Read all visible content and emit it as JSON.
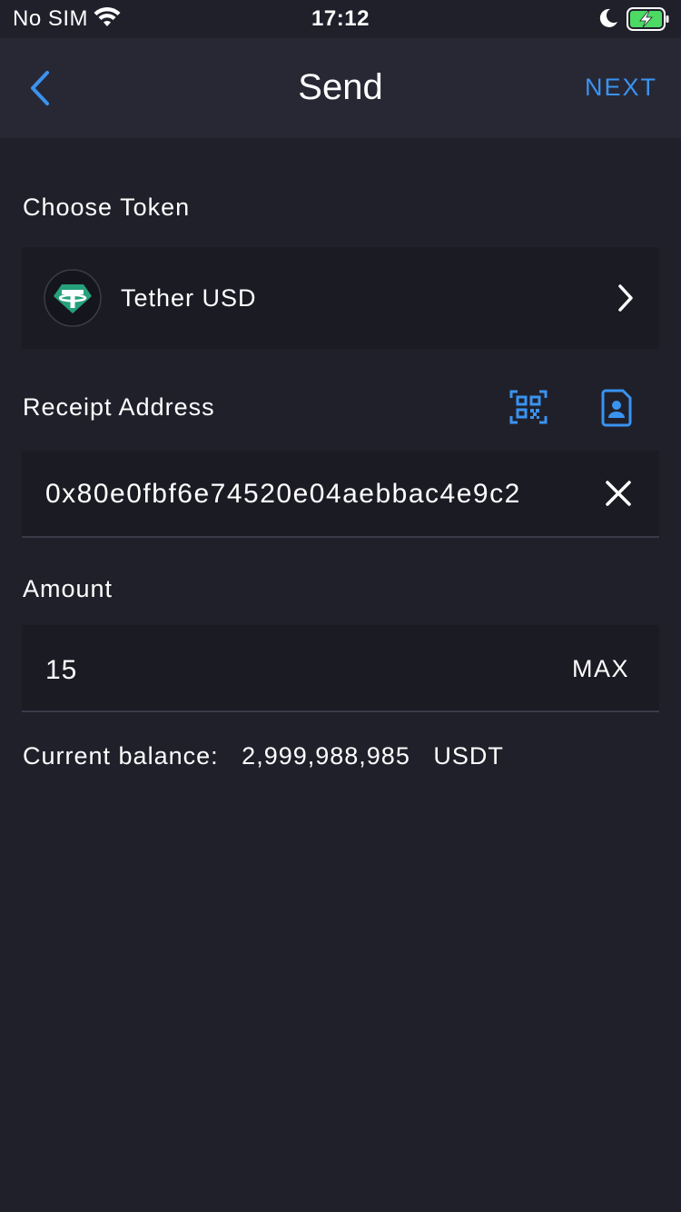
{
  "status_bar": {
    "carrier": "No SIM",
    "time": "17:12",
    "icons": [
      "wifi-icon",
      "moon-icon",
      "battery-charging-icon"
    ],
    "battery_color": "#4cd964"
  },
  "nav": {
    "back_icon": "chevron-left-icon",
    "title": "Send",
    "next_label": "NEXT"
  },
  "token": {
    "section_label": "Choose Token",
    "name": "Tether USD",
    "logo_icon": "tether-logo",
    "chevron_icon": "chevron-right-icon"
  },
  "address": {
    "section_label": "Receipt Address",
    "value": "0x80e0fbf6e74520e04aebbac4e9c2",
    "qr_icon": "qr-scan-icon",
    "contacts_icon": "contact-book-icon",
    "clear_icon": "close-icon"
  },
  "amount": {
    "section_label": "Amount",
    "value": "15",
    "max_label": "MAX"
  },
  "balance": {
    "label": "Current balance:",
    "value": "2,999,988,985",
    "unit": "USDT"
  },
  "colors": {
    "accent": "#3a93f0",
    "background": "#20202b",
    "nav_background": "#282835",
    "field_background": "#1b1b24",
    "tether_green": "#26a17b"
  }
}
